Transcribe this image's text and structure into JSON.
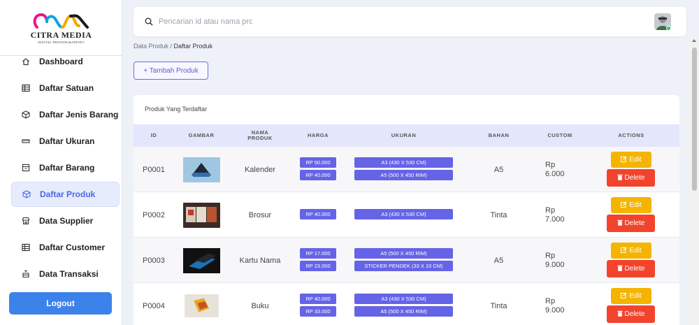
{
  "brand": {
    "name": "CITRA MEDIA",
    "tagline": "DIGITAL PRINTING&OFFSET"
  },
  "sidebar": {
    "items": [
      {
        "label": "Dashboard",
        "icon": "home-icon"
      },
      {
        "label": "Daftar Satuan",
        "icon": "table-icon"
      },
      {
        "label": "Daftar Jenis Barang",
        "icon": "box-icon"
      },
      {
        "label": "Daftar Ukuran",
        "icon": "ruler-icon"
      },
      {
        "label": "Daftar Barang",
        "icon": "archive-icon"
      },
      {
        "label": "Daftar Produk",
        "icon": "box-icon",
        "active": true
      },
      {
        "label": "Data Supplier",
        "icon": "store-icon"
      },
      {
        "label": "Daftar Customer",
        "icon": "table-icon"
      },
      {
        "label": "Data Transaksi",
        "icon": "transaction-icon"
      }
    ],
    "logout_label": "Logout"
  },
  "search": {
    "placeholder": "Pencarian id atau nama prc",
    "value": ""
  },
  "breadcrumb": {
    "parent": "Data Produk",
    "separator": " / ",
    "current": "Daftar Produk"
  },
  "add_button_label": "+ Tambah Produk",
  "card_title": "Produk Yang Terdaftar",
  "table": {
    "headers": [
      "ID",
      "GAMBAR",
      "NAMA PRODUK",
      "HARGA",
      "UKURAN",
      "BAHAN",
      "CUSTOM",
      "ACTIONS"
    ],
    "edit_label": "Edit",
    "delete_label": "Delete",
    "rows": [
      {
        "id": "P0001",
        "image": "calendar-thumbnail",
        "name": "Kalender",
        "prices": [
          "RP 50.000",
          "RP 40.000"
        ],
        "sizes": [
          "A3 (430 X 530 CM)",
          "A5 (500 X 450 RIM)"
        ],
        "bahan": "A5",
        "custom": "Rp\n6.000"
      },
      {
        "id": "P0002",
        "image": "brochure-thumbnail",
        "name": "Brosur",
        "prices": [
          "RP 40.000"
        ],
        "sizes": [
          "A3 (430 X 530 CM)"
        ],
        "bahan": "Tinta",
        "custom": "Rp\n7.000"
      },
      {
        "id": "P0003",
        "image": "business-card-thumbnail",
        "name": "Kartu Nama",
        "prices": [
          "RP 17.000",
          "RP 23.000"
        ],
        "sizes": [
          "A5 (500 X 450 RIM)",
          "STICKER PENDEK (33 X 10 CM)"
        ],
        "bahan": "A5",
        "custom": "Rp\n9.000"
      },
      {
        "id": "P0004",
        "image": "book-thumbnail",
        "name": "Buku",
        "prices": [
          "RP 40.000",
          "RP 33.000"
        ],
        "sizes": [
          "A3 (430 X 530 CM)",
          "A5 (500 X 450 RIM)"
        ],
        "bahan": "Tinta",
        "custom": "Rp\n9.000"
      }
    ]
  },
  "colors": {
    "accent": "#4b66e8",
    "pill": "#6563e6",
    "edit": "#f5b400",
    "delete": "#f2442c",
    "logout": "#3d82ea"
  }
}
